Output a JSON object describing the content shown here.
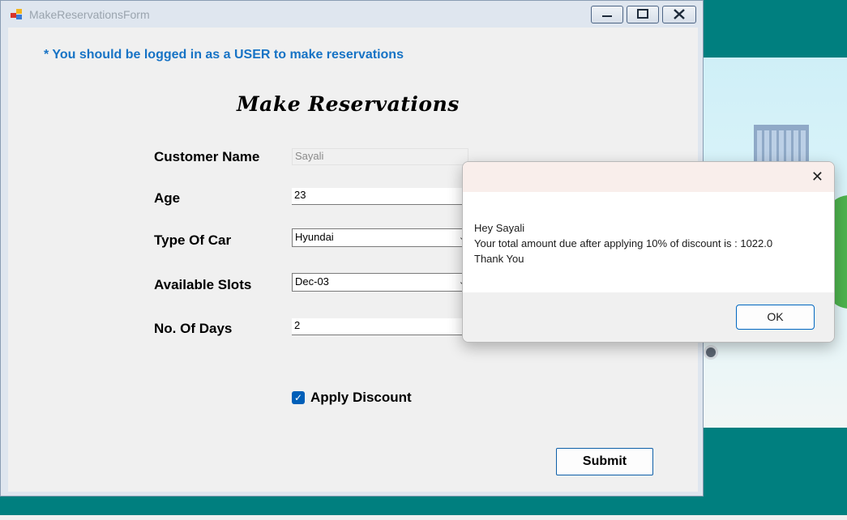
{
  "window": {
    "title": "MakeReservationsForm",
    "icon": "form-app-icon"
  },
  "form": {
    "notice": "* You should be logged in as a USER to make reservations",
    "heading": "Make Reservations",
    "fields": {
      "customer_name": {
        "label": "Customer Name",
        "value": "Sayali"
      },
      "age": {
        "label": "Age",
        "value": "23"
      },
      "type_of_car": {
        "label": "Type Of Car",
        "value": "Hyundai"
      },
      "available_slots": {
        "label": "Available Slots",
        "value": "Dec-03"
      },
      "no_of_days": {
        "label": "No. Of Days",
        "value": "2"
      }
    },
    "apply_discount": {
      "label": "Apply Discount",
      "checked": true
    },
    "submit_label": "Submit"
  },
  "dialog": {
    "line1": "Hey Sayali",
    "line2": "Your total amount due after applying 10% of discount is : 1022.0",
    "line3": "Thank You",
    "ok_label": "OK",
    "close_icon": "close-icon"
  },
  "colors": {
    "desktop": "#007f7f",
    "notice_text": "#1773c5",
    "checkbox": "#005fb8",
    "ok_border": "#0067c0"
  }
}
